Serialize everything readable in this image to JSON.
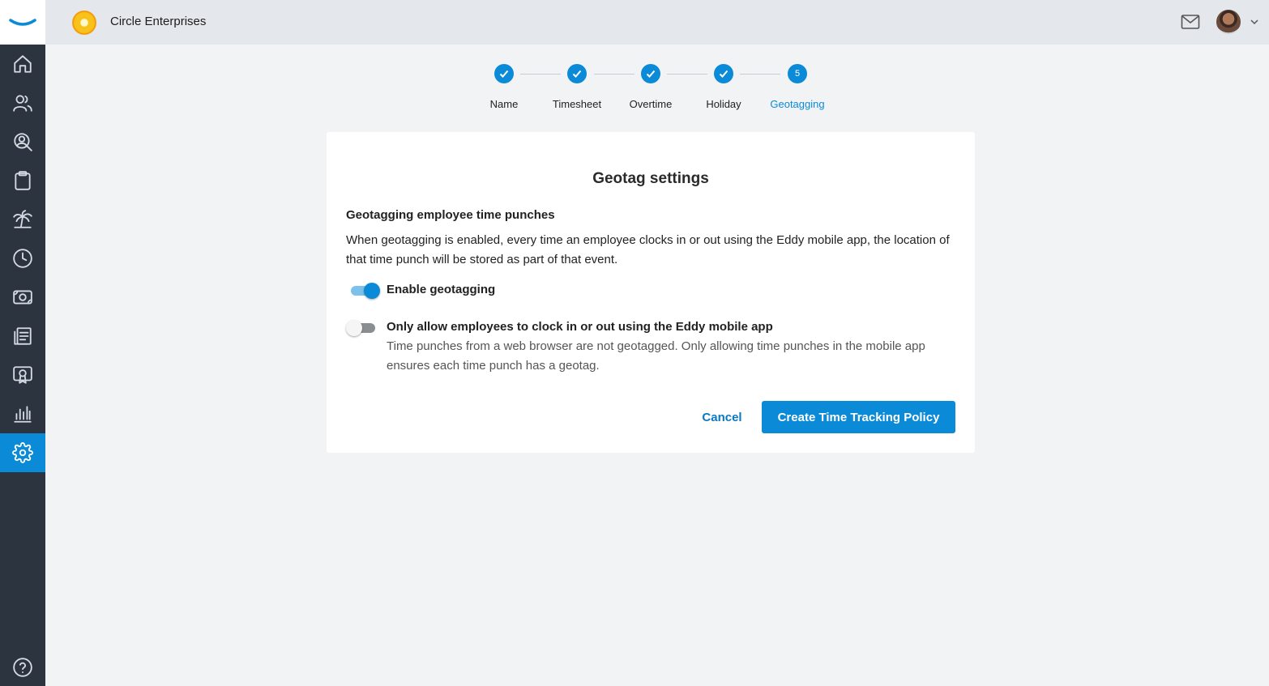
{
  "topbar": {
    "company_name": "Circle Enterprises",
    "mail_icon": "mail-icon",
    "avatar": "user-avatar"
  },
  "sidebar": {
    "items": [
      {
        "name": "home",
        "icon": "home-icon"
      },
      {
        "name": "people",
        "icon": "people-icon"
      },
      {
        "name": "search-people",
        "icon": "person-search-icon"
      },
      {
        "name": "clipboard",
        "icon": "clipboard-icon"
      },
      {
        "name": "time-off",
        "icon": "palm-tree-icon"
      },
      {
        "name": "time",
        "icon": "clock-icon"
      },
      {
        "name": "payroll",
        "icon": "money-icon"
      },
      {
        "name": "documents",
        "icon": "documents-icon"
      },
      {
        "name": "training",
        "icon": "certificate-icon"
      },
      {
        "name": "reports",
        "icon": "bar-chart-icon"
      },
      {
        "name": "settings",
        "icon": "gear-icon",
        "active": true
      },
      {
        "name": "help",
        "icon": "help-icon"
      }
    ]
  },
  "stepper": {
    "steps": [
      {
        "label": "Name",
        "state": "complete"
      },
      {
        "label": "Timesheet",
        "state": "complete"
      },
      {
        "label": "Overtime",
        "state": "complete"
      },
      {
        "label": "Holiday",
        "state": "complete"
      },
      {
        "label": "Geotagging",
        "state": "current",
        "number": "5"
      }
    ]
  },
  "card": {
    "title": "Geotag settings",
    "section_title": "Geotagging employee time punches",
    "description": "When geotagging is enabled, every time an employee clocks in or out using the Eddy mobile app, the location of that time punch will be stored as part of that event.",
    "options": [
      {
        "label": "Enable geotagging",
        "enabled": true
      },
      {
        "label": "Only allow employees to clock in or out using the Eddy mobile app",
        "enabled": false,
        "help": "Time punches from a web browser are not geotagged. Only allowing time punches in the mobile app ensures each time punch has a geotag."
      }
    ],
    "cancel_label": "Cancel",
    "submit_label": "Create Time Tracking Policy"
  },
  "colors": {
    "accent": "#0b8ad8",
    "sidebar": "#2c3440"
  }
}
